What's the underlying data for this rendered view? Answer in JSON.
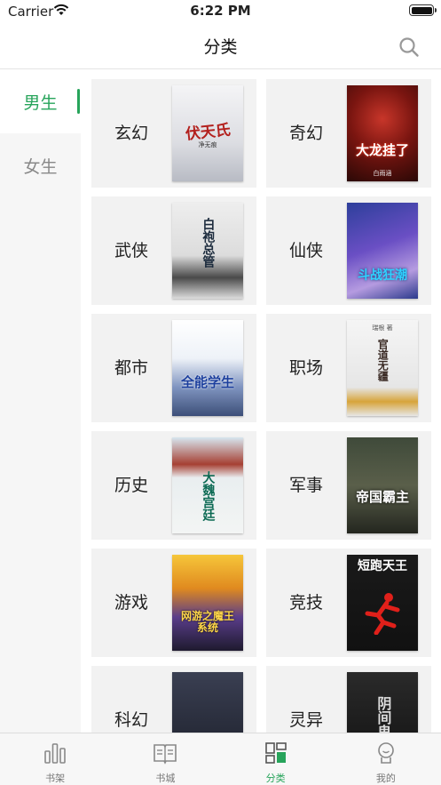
{
  "status_bar": {
    "carrier": "Carrier",
    "time": "6:22 PM"
  },
  "nav": {
    "title": "分类"
  },
  "sidebar": {
    "items": [
      {
        "label": "男生",
        "active": true
      },
      {
        "label": "女生",
        "active": false
      }
    ]
  },
  "categories": [
    {
      "label": "玄幻",
      "cover_title": "伏天氏",
      "cover_sub": "净无痕"
    },
    {
      "label": "奇幻",
      "cover_title": "大龙挂了",
      "cover_sub": "白雨涵"
    },
    {
      "label": "武侠",
      "cover_title": "白袍总管",
      "cover_sub": ""
    },
    {
      "label": "仙侠",
      "cover_title": "斗战狂潮",
      "cover_sub": ""
    },
    {
      "label": "都市",
      "cover_title": "全能学生",
      "cover_sub": ""
    },
    {
      "label": "职场",
      "cover_title": "官道无疆",
      "cover_sub": "瑞根 著"
    },
    {
      "label": "历史",
      "cover_title": "大魏宫廷",
      "cover_sub": ""
    },
    {
      "label": "军事",
      "cover_title": "帝国霸主",
      "cover_sub": ""
    },
    {
      "label": "游戏",
      "cover_title": "网游之魔王系统",
      "cover_sub": ""
    },
    {
      "label": "竞技",
      "cover_title": "短跑天王",
      "cover_sub": ""
    },
    {
      "label": "科幻",
      "cover_title": "",
      "cover_sub": ""
    },
    {
      "label": "灵异",
      "cover_title": "阴间鬼",
      "cover_sub": ""
    }
  ],
  "tabs": [
    {
      "label": "书架",
      "icon": "bookshelf-icon"
    },
    {
      "label": "书城",
      "icon": "bookstore-icon"
    },
    {
      "label": "分类",
      "icon": "category-icon",
      "active": true
    },
    {
      "label": "我的",
      "icon": "profile-icon"
    }
  ],
  "colors": {
    "accent": "#27a45b"
  }
}
